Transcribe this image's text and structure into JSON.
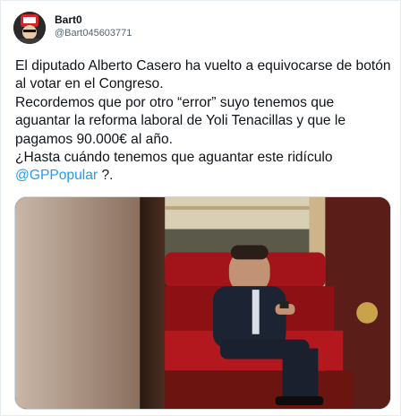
{
  "user": {
    "display_name": "Bart0",
    "handle": "@Bart045603771",
    "avatar_icon": "profile-avatar-icon"
  },
  "tweet": {
    "text_main": "El diputado Alberto Casero ha vuelto a equivocarse de botón al votar en el Congreso.\nRecordemos que por otro “error” suyo tenemos que aguantar la reforma laboral de Yoli Tenacillas y que le pagamos 90.000€ al año.\n¿Hasta cuándo tenemos que aguantar este ridículo ",
    "mention": "@GPPopular",
    "text_end": " ?."
  },
  "media": {
    "kind": "photo",
    "subject": "man-seated-on-red-bench-looking-at-phone"
  },
  "colors": {
    "link": "#1d9bf0",
    "text": "#0f1419",
    "secondary": "#536471",
    "sofa_red": "#a3141a"
  }
}
